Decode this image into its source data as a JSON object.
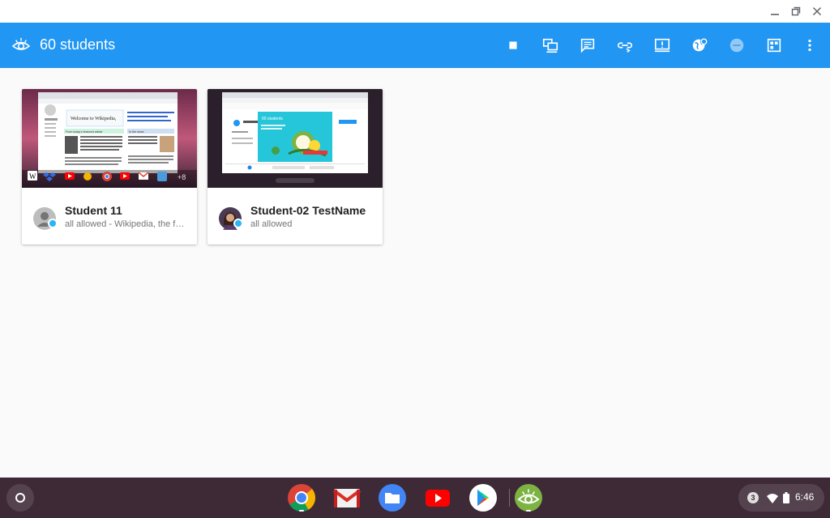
{
  "window": {
    "controls": [
      "minimize-icon",
      "restore-icon",
      "close-icon"
    ]
  },
  "appbar": {
    "title": "60 students",
    "logo_icon": "eye-icon",
    "color": "#2196f3",
    "actions": [
      "stop-icon",
      "share-screen-icon",
      "message-icon",
      "open-link-icon",
      "lock-screen-icon",
      "web-filter-icon",
      "focus-icon",
      "layout-icon",
      "more-vert-icon"
    ]
  },
  "students": [
    {
      "name": "Student 11",
      "status": "all allowed - Wikipedia, the free encyclopedia",
      "avatar": "generic-person-avatar",
      "online_color": "#29b6f6",
      "thumbnail": "wikipedia-screen",
      "thumbnail_texts": {
        "heading": "Welcome to Wikipedia,",
        "section1": "From today's featured article",
        "section2": "In the news",
        "overflow": "+8"
      }
    },
    {
      "name": "Student-02 TestName",
      "status": "all allowed",
      "avatar": "photo-avatar",
      "online_color": "#29b6f6",
      "thumbnail": "classroom-screen",
      "thumbnail_texts": {
        "heading": "60 students"
      }
    }
  ],
  "shelf": {
    "apps": [
      "chrome-icon",
      "gmail-icon",
      "files-icon",
      "youtube-icon",
      "play-store-icon",
      "classroom-eye-icon"
    ],
    "notification_count": "3",
    "time": "6:46"
  }
}
